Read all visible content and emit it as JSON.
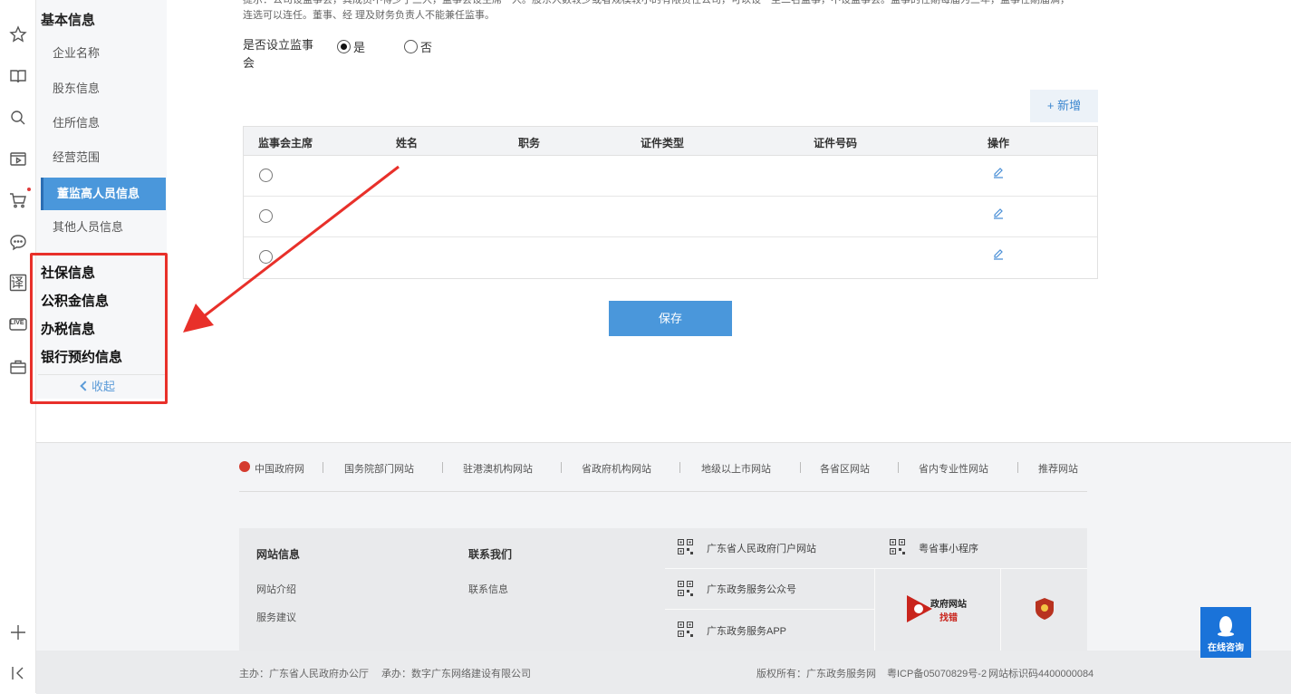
{
  "rail": {
    "icons": [
      "star-icon",
      "book-icon",
      "search-icon",
      "video-icon",
      "cart-icon",
      "chat-icon",
      "translate-icon",
      "live-icon",
      "briefcase-icon",
      "plus-icon",
      "collapse-sidebar-icon"
    ],
    "translate_glyph": "译",
    "live_text": "LIVE"
  },
  "nav": {
    "header": "基本信息",
    "items": [
      "企业名称",
      "股东信息",
      "住所信息",
      "经营范围",
      "董监高人员信息",
      "其他人员信息"
    ],
    "active_index": 4,
    "sections": [
      "社保信息",
      "公积金信息",
      "办税信息",
      "银行预约信息"
    ],
    "collapse": "收起"
  },
  "main": {
    "notice_line1": "提示：公司设监事会，其成员不得少于三人，监事会设主席一人。股东人数较少或者规模较小的有限责任公司，可以设一至二名监事，不设监事会。监事的任期每届为三年，监事任期届满，",
    "notice_line2": "连选可以连任。董事、经 理及财务负责人不能兼任监事。",
    "board_label": "是否设立监事会",
    "yes_label": "是",
    "no_label": "否",
    "board_selected": "是",
    "add_button": "+ 新增",
    "columns": [
      "监事会主席",
      "姓名",
      "职务",
      "证件类型",
      "证件号码",
      "操作"
    ],
    "rows": [
      {
        "name": "",
        "position": "",
        "id_type": "",
        "id_number": ""
      },
      {
        "name": "",
        "position": "",
        "id_type": "",
        "id_number": ""
      },
      {
        "name": "",
        "position": "",
        "id_type": "",
        "id_number": ""
      }
    ],
    "save_button": "保存"
  },
  "footer": {
    "links": [
      "中国政府网",
      "国务院部门网站",
      "驻港澳机构网站",
      "省政府机构网站",
      "地级以上市网站",
      "各省区网站",
      "省内专业性网站",
      "推荐网站"
    ],
    "site_info_title": "网站信息",
    "site_info_links": [
      "网站介绍",
      "服务建议"
    ],
    "contact_title": "联系我们",
    "contact_links": [
      "联系信息"
    ],
    "qr_items": [
      "广东省人民政府门户网站",
      "广东政务服务公众号",
      "广东政务服务APP",
      "粤省事小程序"
    ],
    "gov_badge_line1": "政府网站",
    "gov_badge_line2": "找错",
    "sponsor": "主办：广东省人民政府办公厅",
    "organizer": "承办：数字广东网络建设有限公司",
    "copyright": "版权所有：广东政务服务网",
    "icp": "粤ICP备05070829号-2",
    "site_id": "网站标识码4400000084"
  },
  "consult_label": "在线咨询",
  "colors": {
    "accent": "#4a97db",
    "highlight": "#e8302a",
    "consult": "#1a73d9"
  }
}
